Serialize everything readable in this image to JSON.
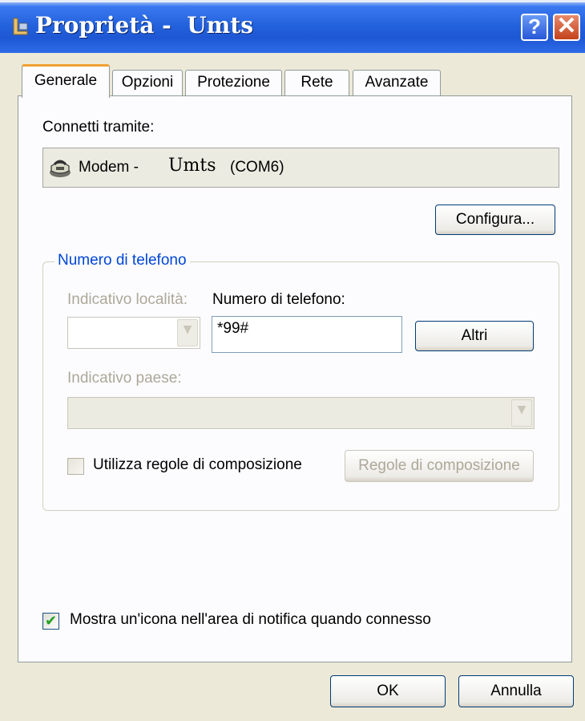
{
  "window": {
    "title_prefix": "Proprietà - ",
    "title_name": "Umts",
    "help_symbol": "?",
    "close_symbol": "✕"
  },
  "tabs": [
    {
      "label": "Generale",
      "active": true
    },
    {
      "label": "Opzioni",
      "active": false
    },
    {
      "label": "Protezione",
      "active": false
    },
    {
      "label": "Rete",
      "active": false
    },
    {
      "label": "Avanzate",
      "active": false
    }
  ],
  "general": {
    "connect_label": "Connetti tramite:",
    "device_prefix": "Modem -",
    "device_name": "Umts",
    "device_port": "(COM6)",
    "configure_button": "Configura..."
  },
  "phone_group": {
    "title": "Numero di telefono",
    "area_code_label": "Indicativo località:",
    "area_code_value": "",
    "phone_label": "Numero di telefono:",
    "phone_value": "*99#",
    "others_button": "Altri",
    "country_label": "Indicativo paese:",
    "country_value": "",
    "use_rules_label": "Utilizza regole di composizione",
    "use_rules_checked": false,
    "rules_button": "Regole di composizione"
  },
  "notify": {
    "label": "Mostra un'icona nell'area di notifica quando connesso",
    "checked": true,
    "check_glyph": "✔"
  },
  "footer": {
    "ok_button": "OK",
    "cancel_button": "Annulla"
  },
  "colors": {
    "title_bar": "#2362dd",
    "active_tab_accent": "#f0a030",
    "group_title": "#0046d5",
    "disabled_text": "#aca899"
  },
  "icons": {
    "title": "network-connection-icon",
    "device": "modem-icon",
    "dropdown": "chevron-down-icon"
  }
}
